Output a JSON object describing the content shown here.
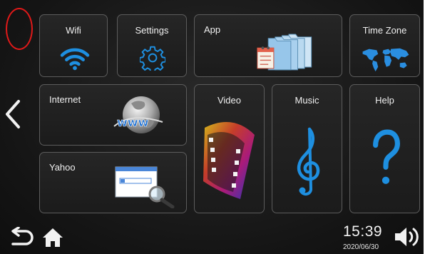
{
  "tiles": {
    "wifi": "Wifi",
    "settings": "Settings",
    "app": "App",
    "timezone": "Time Zone",
    "internet": "Internet",
    "video": "Video",
    "music": "Music",
    "help": "Help",
    "yahoo": "Yahoo"
  },
  "status": {
    "time": "15:39",
    "date": "2020/06/30"
  },
  "icons": {
    "nav_back": "back-arrow-icon",
    "home": "home-icon",
    "volume": "volume-icon",
    "page_back": "chevron-left-icon"
  },
  "colors": {
    "accent_blue": "#1e8fe0",
    "annotation_red": "#e01919"
  }
}
